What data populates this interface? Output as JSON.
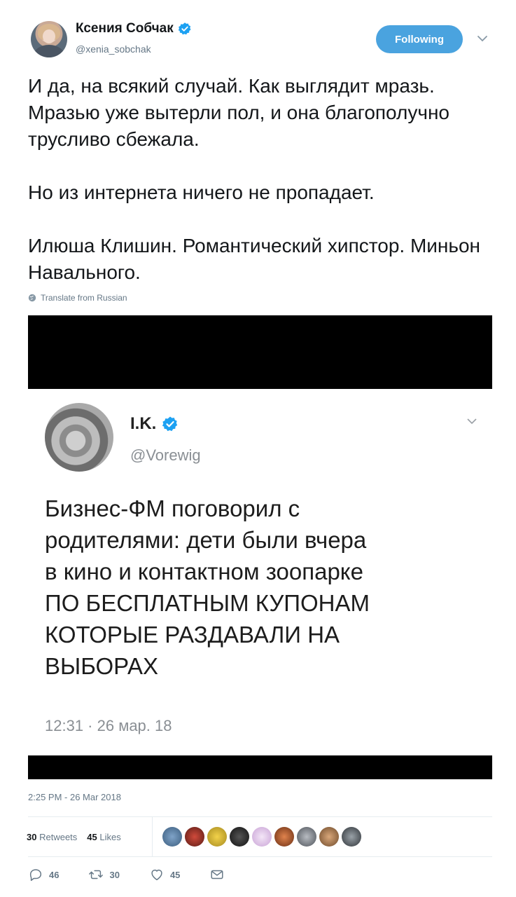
{
  "author": {
    "display_name": "Ксения Собчак",
    "handle": "@xenia_sobchak",
    "verified_icon": "verified-badge-icon"
  },
  "follow_button": {
    "label": "Following"
  },
  "tweet": {
    "paragraphs": [
      "И да, на всякий случай. Как выглядит мразь. Мразью уже вытерли пол, и она благополучно трусливо сбежала.",
      "Но из интернета ничего не пропадает.",
      "Илюша Клишин. Романтический хипстор. Миньон Навального."
    ],
    "translate_label": "Translate from Russian",
    "timestamp": "2:25 PM - 26 Mar 2018"
  },
  "embedded_tweet": {
    "display_name": "I.K.",
    "handle": "@Vorewig",
    "lines": [
      "Бизнес-ФМ поговорил с",
      "родителями: дети были вчера",
      "в кино и контактном зоопарке",
      "ПО БЕСПЛАТНЫМ КУПОНАМ",
      "КОТОРЫЕ РАЗДАВАЛИ НА",
      "ВЫБОРАХ"
    ],
    "time": "12:31 · 26 мар. 18"
  },
  "stats": {
    "retweets_count": "30",
    "retweets_label": "Retweets",
    "likes_count": "45",
    "likes_label": "Likes"
  },
  "actions": {
    "reply_count": "46",
    "retweet_count": "30",
    "like_count": "45"
  },
  "colors": {
    "accent": "#4aa3df",
    "secondary_text": "#657786",
    "media_background": "#000000"
  }
}
